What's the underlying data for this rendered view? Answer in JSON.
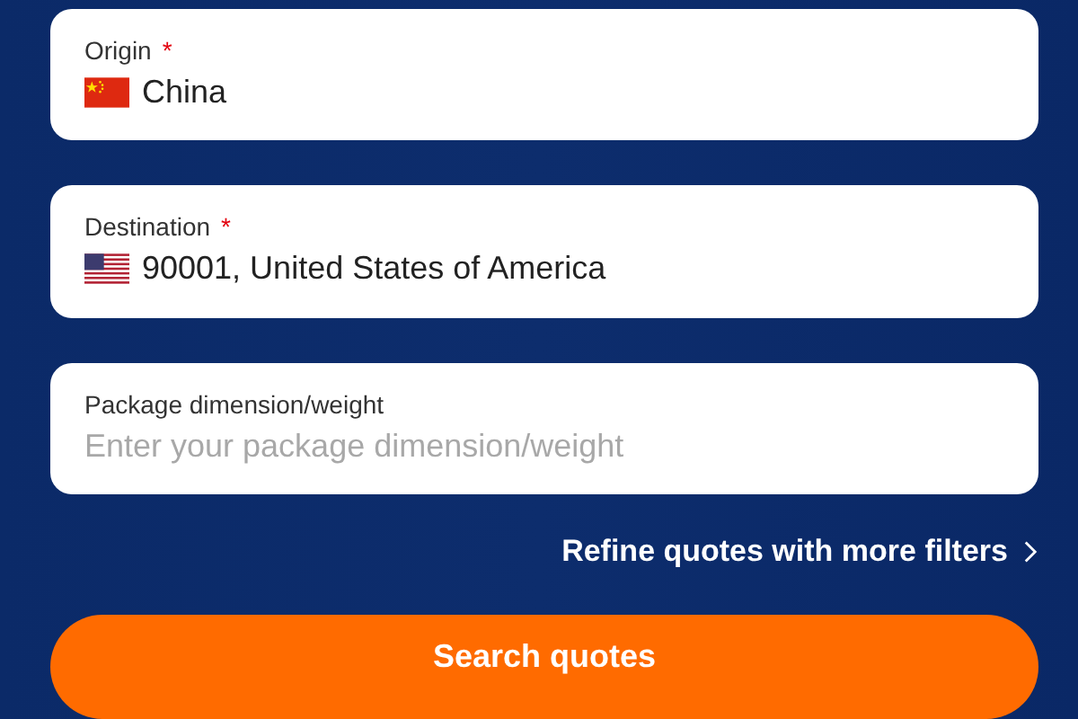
{
  "fields": [
    {
      "label": "Origin",
      "required_mark": "*",
      "value": "China"
    },
    {
      "label": "Destination",
      "required_mark": "*",
      "value": "90001, United States of America"
    },
    {
      "label": "Package dimension/weight",
      "placeholder": "Enter your package dimension/weight"
    }
  ],
  "filters_link": "Refine quotes with more filters",
  "search_button": "Search quotes"
}
